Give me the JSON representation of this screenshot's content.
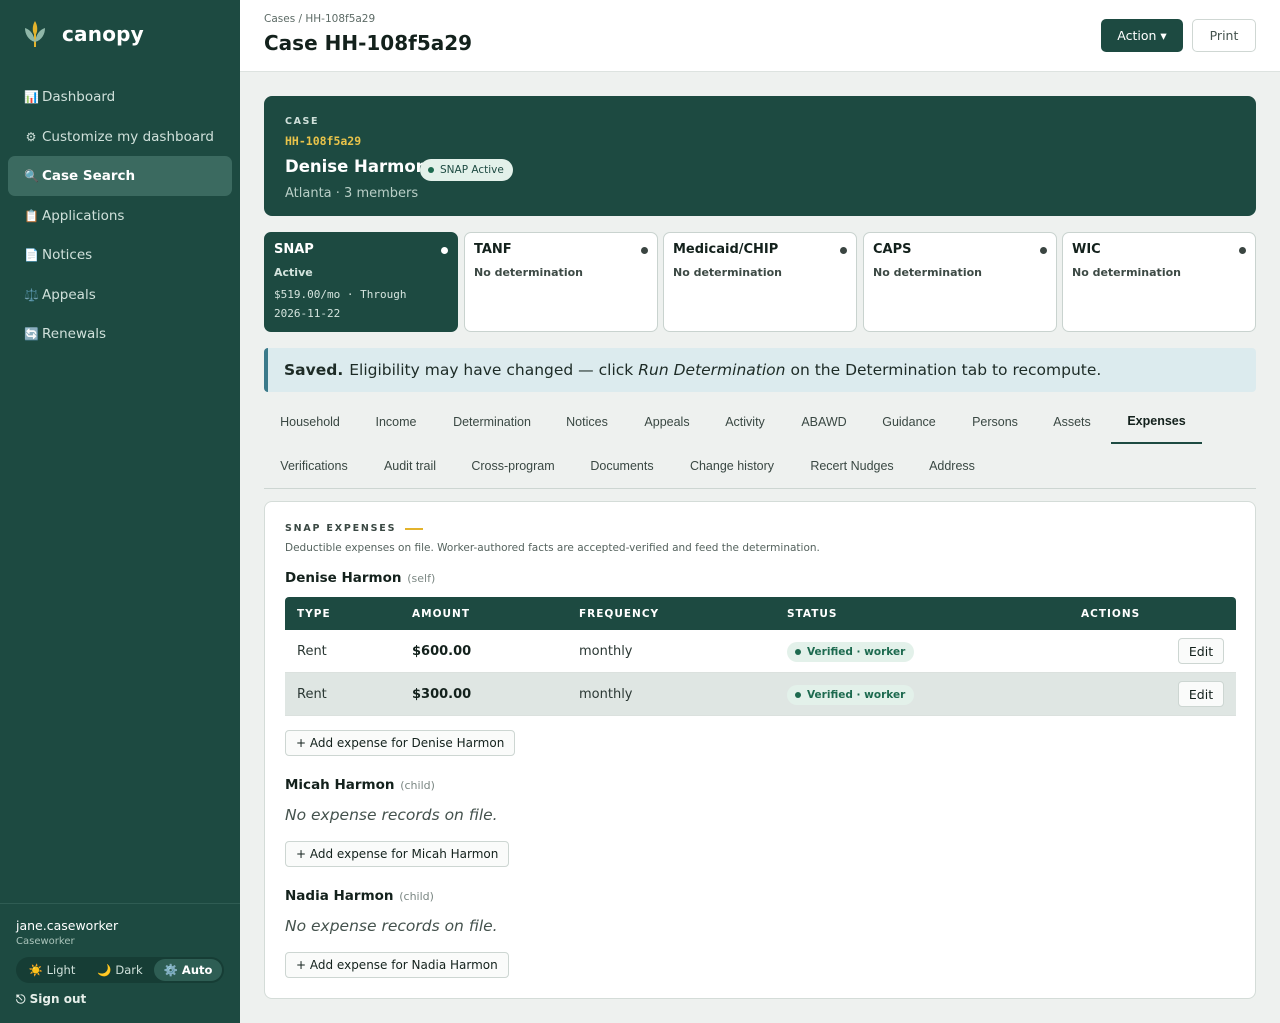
{
  "brand": {
    "name": "canopy",
    "icon": "wheat-icon"
  },
  "sidebar": {
    "items": [
      {
        "icon": "📊",
        "label": "Dashboard"
      },
      {
        "icon": "⚙",
        "label": "Customize my dashboard"
      },
      {
        "icon": "🔍",
        "label": "Case Search"
      },
      {
        "icon": "📋",
        "label": "Applications"
      },
      {
        "icon": "📄",
        "label": "Notices"
      },
      {
        "icon": "⚖️",
        "label": "Appeals"
      },
      {
        "icon": "🔄",
        "label": "Renewals"
      }
    ],
    "active_item": "Case Search"
  },
  "user": {
    "name": "jane.caseworker",
    "role": "Caseworker",
    "theme": {
      "light": "☀️ Light",
      "dark": "🌙 Dark",
      "auto": "⚙️ Auto",
      "selected": "auto"
    },
    "sign_out": "⎋ Sign out"
  },
  "header": {
    "breadcrumb": "Cases / HH-108f5a29",
    "title": "Case HH-108f5a29",
    "action_label": "Action ▾",
    "print_label": "Print"
  },
  "case": {
    "label": "CASE",
    "id": "HH-108f5a29",
    "name": "Denise Harmon",
    "badge": "SNAP Active",
    "meta": "Atlanta · 3 members"
  },
  "programs": [
    {
      "name": "SNAP",
      "status": "Active",
      "detail_1": "$519.00/mo · Through",
      "detail_2": "2026-11-22",
      "active": true
    },
    {
      "name": "TANF",
      "status": "No determination"
    },
    {
      "name": "Medicaid/CHIP",
      "status": "No determination"
    },
    {
      "name": "CAPS",
      "status": "No determination"
    },
    {
      "name": "WIC",
      "status": "No determination"
    }
  ],
  "alert": {
    "strong": "Saved.",
    "text_1": "Eligibility may have changed — click",
    "emphasis": "Run Determination",
    "text_2": "on the Determination tab to recompute."
  },
  "tabs": {
    "row1": [
      "Household",
      "Income",
      "Determination",
      "Notices",
      "Appeals",
      "Activity",
      "ABAWD",
      "Guidance",
      "Persons",
      "Assets",
      "Expenses"
    ],
    "row2": [
      "Verifications",
      "Audit trail",
      "Cross-program",
      "Documents",
      "Change history",
      "Recert Nudges",
      "Address"
    ],
    "active": "Expenses"
  },
  "expenses": {
    "title": "SNAP EXPENSES",
    "description": "Deductible expenses on file. Worker-authored facts are accepted-verified and feed the determination.",
    "columns": [
      "TYPE",
      "AMOUNT",
      "FREQUENCY",
      "STATUS",
      "ACTIONS"
    ],
    "edit_label": "Edit",
    "empty_text": "No expense records on file.",
    "people": [
      {
        "name": "Denise Harmon",
        "relation": "(self)",
        "rows": [
          {
            "type": "Rent",
            "amount": "$600.00",
            "frequency": "monthly",
            "status": "Verified · worker"
          },
          {
            "type": "Rent",
            "amount": "$300.00",
            "frequency": "monthly",
            "status": "Verified · worker"
          }
        ],
        "add_label": "+ Add expense for Denise Harmon"
      },
      {
        "name": "Micah Harmon",
        "relation": "(child)",
        "rows": [],
        "add_label": "+ Add expense for Micah Harmon"
      },
      {
        "name": "Nadia Harmon",
        "relation": "(child)",
        "rows": [],
        "add_label": "+ Add expense for Nadia Harmon"
      }
    ]
  },
  "colors": {
    "primary": "#1d4a41",
    "accent": "#e8c34a",
    "alert_bg": "#dcebee"
  }
}
